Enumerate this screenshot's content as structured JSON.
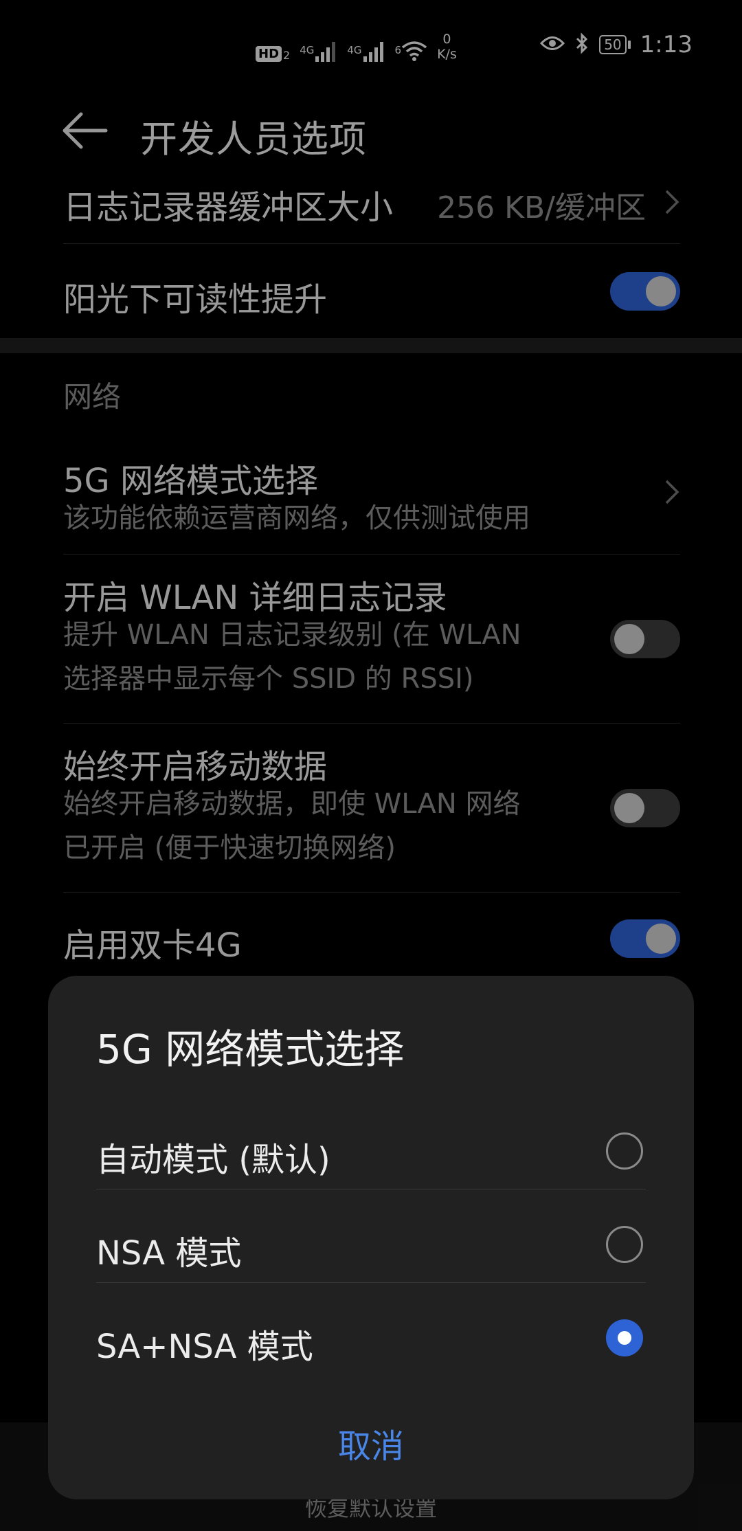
{
  "status_bar": {
    "hd_badge": "HD",
    "hd_sub": "2",
    "net1": "4G",
    "net2": "4G",
    "wifi_num": "6",
    "speed_value": "0",
    "speed_unit": "K/s",
    "battery": "50",
    "time": "1:13"
  },
  "header": {
    "title": "开发人员选项"
  },
  "settings": {
    "logger_buffer": {
      "label": "日志记录器缓冲区大小",
      "value": "256 KB/缓冲区"
    },
    "sunlight": {
      "label": "阳光下可读性提升",
      "enabled": true
    },
    "network_section": "网络",
    "nr_mode": {
      "label": "5G 网络模式选择",
      "sub": "该功能依赖运营商网络，仅供测试使用"
    },
    "wlan_log": {
      "label": "开启 WLAN 详细日志记录",
      "sub1": "提升 WLAN 日志记录级别 (在 WLAN",
      "sub2": "选择器中显示每个 SSID 的 RSSI)",
      "enabled": false
    },
    "mobile_data": {
      "label": "始终开启移动数据",
      "sub1": "始终开启移动数据，即使 WLAN 网络",
      "sub2": "已开启 (便于快速切换网络)",
      "enabled": false
    },
    "dual_4g": {
      "label": "启用双卡4G",
      "enabled": true
    }
  },
  "bottom": {
    "restore_label": "恢复默认设置"
  },
  "dialog": {
    "title": "5G 网络模式选择",
    "options": [
      {
        "label": "自动模式 (默认)",
        "selected": false
      },
      {
        "label": "NSA 模式",
        "selected": false
      },
      {
        "label": "SA+NSA 模式",
        "selected": true
      }
    ],
    "cancel_label": "取消"
  },
  "colors": {
    "accent": "#2e63d6",
    "link": "#4a86e8"
  }
}
